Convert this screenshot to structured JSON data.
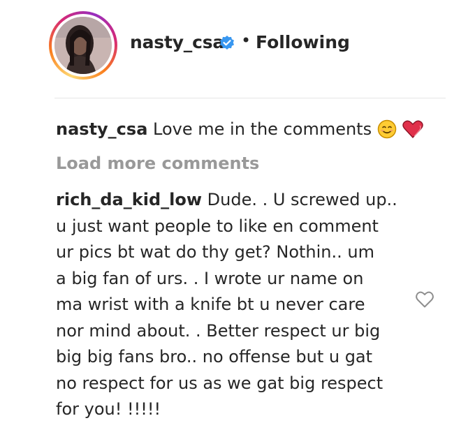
{
  "header": {
    "username": "nasty_csa",
    "verified_icon": "verified-badge-icon",
    "separator": "•",
    "follow_status": "Following"
  },
  "caption": {
    "username": "nasty_csa",
    "text": "Love me in the comments",
    "emojis": [
      "smiling-face-icon",
      "heart-icon"
    ]
  },
  "load_more": "Load more comments",
  "comment": {
    "username": "rich_da_kid_low",
    "lines": [
      " Dude. . U screwed up..",
      "u just want people to like en comment",
      "ur pics bt wat do thy get? Nothin.. um",
      "a big fan of urs. . I wrote ur name on",
      "ma wrist with a knife bt u never care",
      "nor mind about. . Better respect ur big",
      "big big fans bro.. no offense but u gat",
      "no respect for us as we gat big respect",
      "for you! !!!!!"
    ],
    "like_icon": "heart-outline-icon"
  },
  "colors": {
    "text": "#262626",
    "muted": "#999999",
    "verified": "#3897f0",
    "divider": "#e6e6e6"
  }
}
